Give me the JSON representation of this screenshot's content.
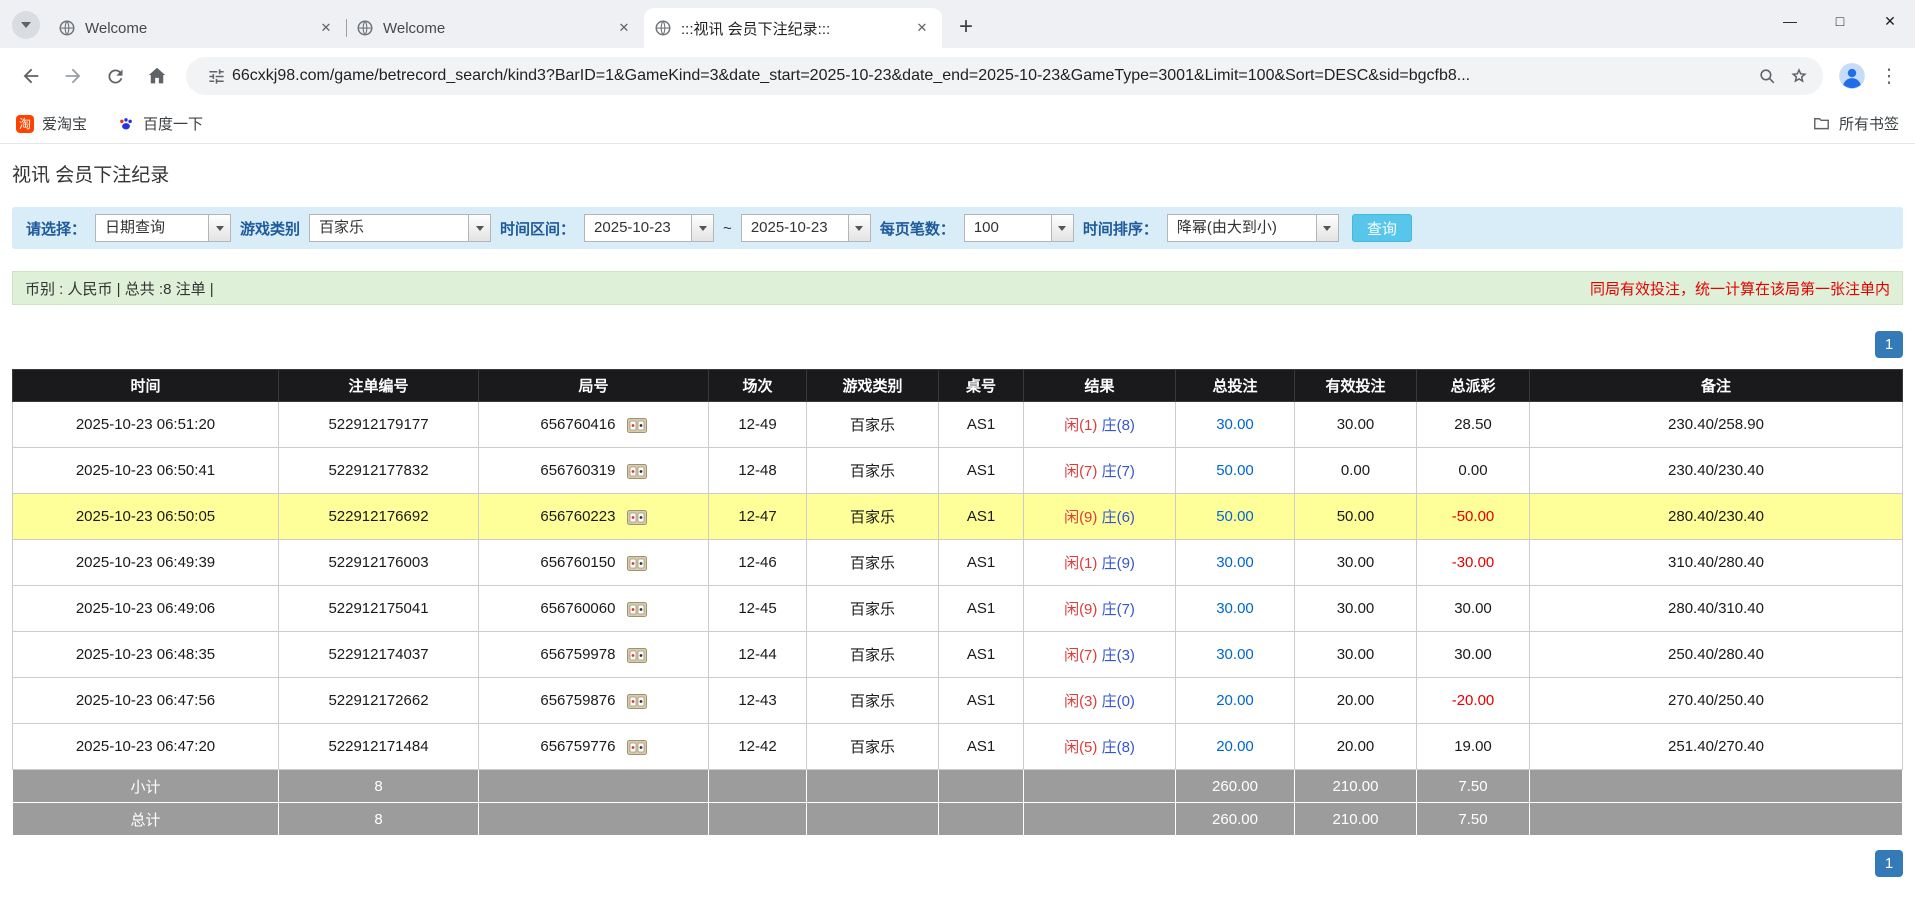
{
  "colors": {
    "accent": "#337ab7",
    "filter_bg": "#d8edf7",
    "summary_bg": "#dff0d8",
    "highlight": "#ffff99",
    "negative": "#e60000",
    "link": "#0066cc",
    "player": "#e03a3a",
    "banker": "#3554d1",
    "header_bg": "#1a1a1c",
    "footer_bg": "#9c9c9c",
    "button_bg": "#58c5ea"
  },
  "icons": {
    "tab_close": "✕",
    "new_tab": "+",
    "window_minimize": "—",
    "window_maximize": "□",
    "window_close": "✕",
    "menu_kebab": "⋮",
    "taobao_glyph": "淘"
  },
  "browser": {
    "tabs": [
      {
        "label": "Welcome"
      },
      {
        "label": "Welcome"
      },
      {
        "label": ":::视讯 会员下注纪录:::"
      }
    ],
    "url": "66cxkj98.com/game/betrecord_search/kind3?BarID=1&GameKind=3&date_start=2025-10-23&date_end=2025-10-23&GameType=3001&Limit=100&Sort=DESC&sid=bgcfb8...",
    "bookmarks": [
      {
        "label": "爱淘宝"
      },
      {
        "label": "百度一下"
      }
    ],
    "all_bookmarks_label": "所有书签"
  },
  "page": {
    "title": "视讯 会员下注纪录",
    "filters": {
      "select_label": "请选择：",
      "select_value": "日期查询",
      "game_type_label": "游戏类别",
      "game_type_value": "百家乐",
      "date_range_label": "时间区间：",
      "date_start": "2025-10-23",
      "date_separator": "~",
      "date_end": "2025-10-23",
      "page_size_label": "每页笔数：",
      "page_size_value": "100",
      "sort_label": "时间排序：",
      "sort_value": "降幂(由大到小)",
      "search_button": "查询"
    },
    "summary": {
      "left": "币别 : 人民币 | 总共 :8 注单 |",
      "right": "同局有效投注，统一计算在该局第一张注单内"
    },
    "pagination": {
      "page": "1"
    },
    "table": {
      "headers": [
        "时间",
        "注单编号",
        "局号",
        "场次",
        "游戏类别",
        "桌号",
        "结果",
        "总投注",
        "有效投注",
        "总派彩",
        "备注"
      ],
      "rows": [
        {
          "time": "2025-10-23 06:51:20",
          "bet_id": "522912179177",
          "round": "656760416",
          "session": "12-49",
          "game": "百家乐",
          "table_no": "AS1",
          "result_player": "闲(1)",
          "result_banker": "庄(8)",
          "total_bet": "30.00",
          "valid_bet": "30.00",
          "payout": "28.50",
          "note": "230.40/258.90",
          "highlight": false
        },
        {
          "time": "2025-10-23 06:50:41",
          "bet_id": "522912177832",
          "round": "656760319",
          "session": "12-48",
          "game": "百家乐",
          "table_no": "AS1",
          "result_player": "闲(7)",
          "result_banker": "庄(7)",
          "total_bet": "50.00",
          "valid_bet": "0.00",
          "payout": "0.00",
          "note": "230.40/230.40",
          "highlight": false
        },
        {
          "time": "2025-10-23 06:50:05",
          "bet_id": "522912176692",
          "round": "656760223",
          "session": "12-47",
          "game": "百家乐",
          "table_no": "AS1",
          "result_player": "闲(9)",
          "result_banker": "庄(6)",
          "total_bet": "50.00",
          "valid_bet": "50.00",
          "payout": "-50.00",
          "note": "280.40/230.40",
          "highlight": true
        },
        {
          "time": "2025-10-23 06:49:39",
          "bet_id": "522912176003",
          "round": "656760150",
          "session": "12-46",
          "game": "百家乐",
          "table_no": "AS1",
          "result_player": "闲(1)",
          "result_banker": "庄(9)",
          "total_bet": "30.00",
          "valid_bet": "30.00",
          "payout": "-30.00",
          "note": "310.40/280.40",
          "highlight": false
        },
        {
          "time": "2025-10-23 06:49:06",
          "bet_id": "522912175041",
          "round": "656760060",
          "session": "12-45",
          "game": "百家乐",
          "table_no": "AS1",
          "result_player": "闲(9)",
          "result_banker": "庄(7)",
          "total_bet": "30.00",
          "valid_bet": "30.00",
          "payout": "30.00",
          "note": "280.40/310.40",
          "highlight": false
        },
        {
          "time": "2025-10-23 06:48:35",
          "bet_id": "522912174037",
          "round": "656759978",
          "session": "12-44",
          "game": "百家乐",
          "table_no": "AS1",
          "result_player": "闲(7)",
          "result_banker": "庄(3)",
          "total_bet": "30.00",
          "valid_bet": "30.00",
          "payout": "30.00",
          "note": "250.40/280.40",
          "highlight": false
        },
        {
          "time": "2025-10-23 06:47:56",
          "bet_id": "522912172662",
          "round": "656759876",
          "session": "12-43",
          "game": "百家乐",
          "table_no": "AS1",
          "result_player": "闲(3)",
          "result_banker": "庄(0)",
          "total_bet": "20.00",
          "valid_bet": "20.00",
          "payout": "-20.00",
          "note": "270.40/250.40",
          "highlight": false
        },
        {
          "time": "2025-10-23 06:47:20",
          "bet_id": "522912171484",
          "round": "656759776",
          "session": "12-42",
          "game": "百家乐",
          "table_no": "AS1",
          "result_player": "闲(5)",
          "result_banker": "庄(8)",
          "total_bet": "20.00",
          "valid_bet": "20.00",
          "payout": "19.00",
          "note": "251.40/270.40",
          "highlight": false
        }
      ],
      "subtotal": {
        "label": "小计",
        "count": "8",
        "total_bet": "260.00",
        "valid_bet": "210.00",
        "payout": "7.50"
      },
      "total": {
        "label": "总计",
        "count": "8",
        "total_bet": "260.00",
        "valid_bet": "210.00",
        "payout": "7.50"
      }
    }
  }
}
